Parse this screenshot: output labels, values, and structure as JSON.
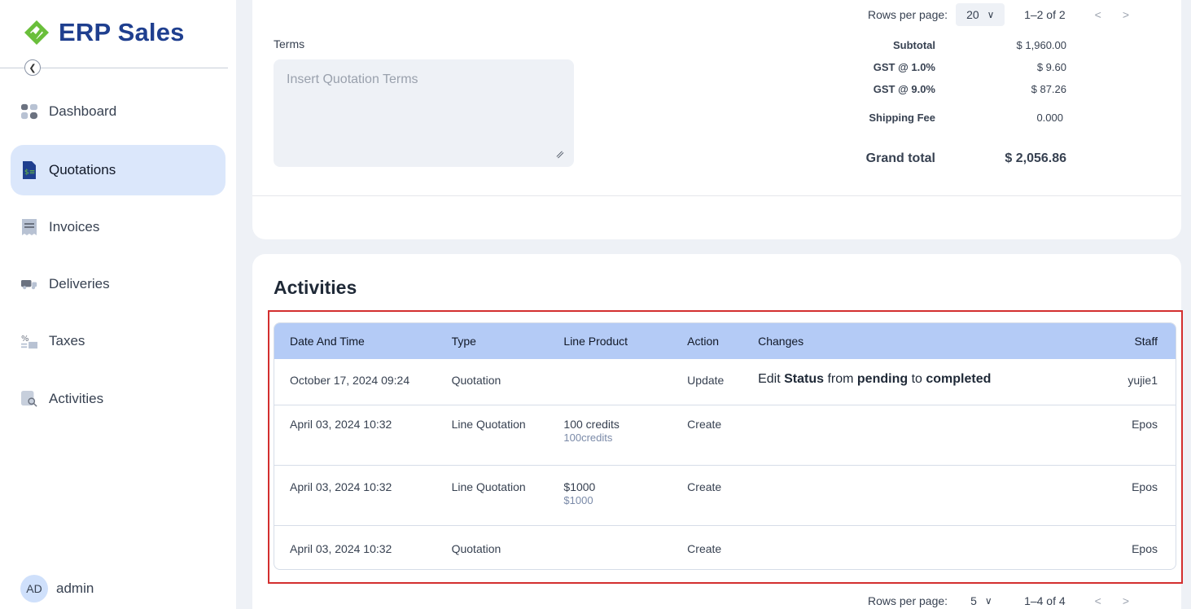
{
  "app": {
    "title": "ERP Sales"
  },
  "sidebar": {
    "items": [
      {
        "label": "Dashboard",
        "icon": "dashboard-icon",
        "active": false
      },
      {
        "label": "Quotations",
        "icon": "quotation-icon",
        "active": true
      },
      {
        "label": "Invoices",
        "icon": "invoice-icon",
        "active": false
      },
      {
        "label": "Deliveries",
        "icon": "truck-icon",
        "active": false
      },
      {
        "label": "Taxes",
        "icon": "tax-icon",
        "active": false
      },
      {
        "label": "Activities",
        "icon": "activity-icon",
        "active": false
      }
    ],
    "user": {
      "initials": "AD",
      "name": "admin"
    }
  },
  "top_pagination": {
    "label": "Rows per page:",
    "value": "20",
    "range": "1–2 of 2"
  },
  "terms": {
    "label": "Terms",
    "placeholder": "Insert Quotation Terms"
  },
  "totals": {
    "subtotal_label": "Subtotal",
    "subtotal": "$ 1,960.00",
    "gst1_label": "GST @ 1.0%",
    "gst1": "$ 9.60",
    "gst9_label": "GST @ 9.0%",
    "gst9": "$ 87.26",
    "shipping_label": "Shipping Fee",
    "shipping": "0.000",
    "grand_label": "Grand total",
    "grand": "$ 2,056.86"
  },
  "activities": {
    "title": "Activities",
    "columns": [
      "Date And Time",
      "Type",
      "Line Product",
      "Action",
      "Changes",
      "Staff"
    ],
    "rows": [
      {
        "date": "October 17, 2024 09:24",
        "type": "Quotation",
        "product": "",
        "product_sub": "",
        "action": "Update",
        "changes": {
          "pre": "Edit ",
          "field": "Status",
          "mid1": " from ",
          "from": "pending",
          "mid2": " to ",
          "to": "completed"
        },
        "staff": "yujie1"
      },
      {
        "date": "April 03, 2024 10:32",
        "type": "Line Quotation",
        "product": "100 credits",
        "product_sub": "100credits",
        "action": "Create",
        "staff": "Epos"
      },
      {
        "date": "April 03, 2024 10:32",
        "type": "Line Quotation",
        "product": "$1000",
        "product_sub": "$1000",
        "action": "Create",
        "staff": "Epos"
      },
      {
        "date": "April 03, 2024 10:32",
        "type": "Quotation",
        "product": "",
        "product_sub": "",
        "action": "Create",
        "staff": "Epos"
      }
    ],
    "pagination": {
      "label": "Rows per page:",
      "value": "5",
      "range": "1–4 of 4"
    }
  },
  "colors": {
    "brand": "#1f3f8f",
    "logo_green": "#6abf3b",
    "active_nav": "#dbe7fb",
    "table_header": "#b4cbf6",
    "highlight": "#d32f2f"
  }
}
